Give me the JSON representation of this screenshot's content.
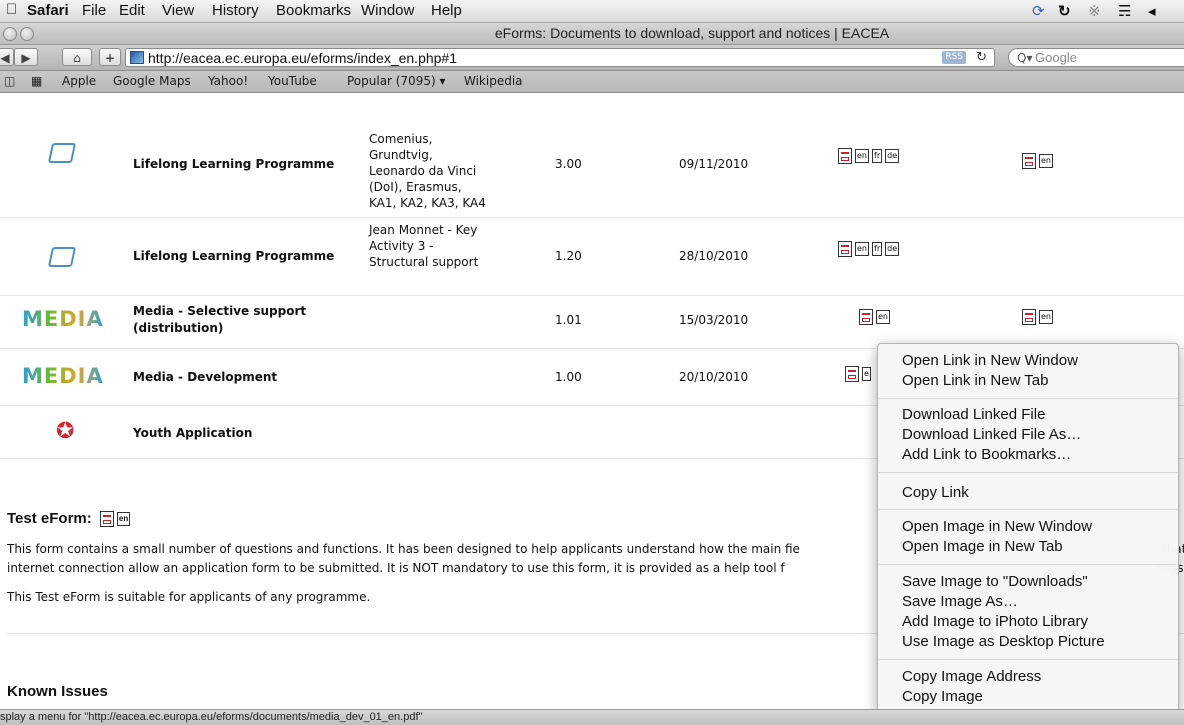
{
  "menubar": {
    "items": [
      "Safari",
      "File",
      "Edit",
      "View",
      "History",
      "Bookmarks",
      "Window",
      "Help"
    ]
  },
  "window": {
    "title": "eForms: Documents to download, support and notices | EACEA"
  },
  "toolbar": {
    "url": "http://eacea.ec.europa.eu/eforms/index_en.php#1",
    "rss_label": "RSS",
    "search_placeholder": "Google"
  },
  "bookmarks": [
    "Apple",
    "Google Maps",
    "Yahoo!",
    "YouTube",
    "Popular (7095)",
    "Wikipedia"
  ],
  "table": {
    "rows": [
      {
        "logo": "laptop",
        "programme": "Lifelong Learning Programme",
        "action": [
          "Comenius,",
          "Grundtvig,",
          "Leonardo da Vinci",
          "(DoI), Erasmus,",
          "KA1, KA2, KA3, KA4"
        ],
        "version": "3.00",
        "date": "09/11/2010",
        "langs1": [
          "en",
          "fr",
          "de"
        ],
        "langs2": [
          "en"
        ]
      },
      {
        "logo": "laptop",
        "programme": "Lifelong Learning Programme",
        "action": [
          "Jean Monnet - Key",
          "Activity 3 -",
          "Structural support"
        ],
        "version": "1.20",
        "date": "28/10/2010",
        "langs1": [
          "en",
          "fr",
          "de"
        ],
        "langs2": []
      },
      {
        "logo": "MEDIA",
        "programme": "Media - Selective support (distribution)",
        "programme_lines": [
          "Media - Selective support",
          "(distribution)"
        ],
        "action": [],
        "version": "1.01",
        "date": "15/03/2010",
        "langs1": [
          "en"
        ],
        "langs2": [
          "en"
        ]
      },
      {
        "logo": "MEDIA",
        "programme": "Media - Development",
        "action": [],
        "version": "1.00",
        "date": "20/10/2010",
        "langs1": [
          "e"
        ],
        "langs2": []
      },
      {
        "logo": "youth",
        "programme": "Youth Application",
        "action": [],
        "version": "",
        "date": "",
        "langs1": [],
        "langs2": []
      }
    ]
  },
  "test_eform": {
    "heading": "Test eForm:",
    "lang": "en",
    "para1_line1": "This form contains a small number of questions and functions. It has been designed to help applicants understand how the main fie",
    "para1_line1_tail": "that",
    "para1_line2": "internet connection allow an application form to be submitted. It is NOT mandatory to use this form, it is provided as a help tool f",
    "para1_line2_tail": "missi",
    "para2": "This Test eForm is suitable for applicants of any programme."
  },
  "known_issues": {
    "heading": "Known Issues"
  },
  "context_menu": {
    "groups": [
      [
        "Open Link in New Window",
        "Open Link in New Tab"
      ],
      [
        "Download Linked File",
        "Download Linked File As…",
        "Add Link to Bookmarks…"
      ],
      [
        "Copy Link"
      ],
      [
        "Open Image in New Window",
        "Open Image in New Tab"
      ],
      [
        "Save Image to \"Downloads\"",
        "Save Image As…",
        "Add Image to iPhoto Library",
        "Use Image as Desktop Picture"
      ],
      [
        "Copy Image Address",
        "Copy Image"
      ]
    ]
  },
  "status": {
    "text": "splay a menu for \"http://eacea.ec.europa.eu/eforms/documents/media_dev_01_en.pdf\""
  }
}
